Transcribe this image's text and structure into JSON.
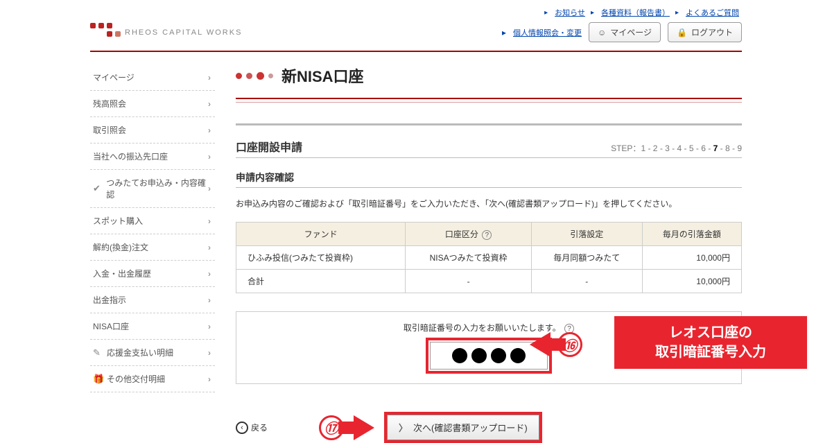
{
  "header": {
    "top_links": [
      "お知らせ",
      "各種資料（報告書）",
      "よくあるご質問"
    ],
    "personal_info": "個人情報照会・変更",
    "mypage_btn": "マイページ",
    "logout_btn": "ログアウト",
    "brand": "RHEOS CAPITAL WORKS"
  },
  "sidebar": {
    "items": [
      {
        "label": "マイページ",
        "icon": ""
      },
      {
        "label": "残高照会",
        "icon": ""
      },
      {
        "label": "取引照会",
        "icon": ""
      },
      {
        "label": "当社への振込先口座",
        "icon": ""
      },
      {
        "label": "つみたてお申込み・内容確認",
        "icon": "✔"
      },
      {
        "label": "スポット購入",
        "icon": ""
      },
      {
        "label": "解約(換金)注文",
        "icon": ""
      },
      {
        "label": "入金・出金履歴",
        "icon": ""
      },
      {
        "label": "出金指示",
        "icon": ""
      },
      {
        "label": "NISA口座",
        "icon": ""
      },
      {
        "label": "応援金支払い明細",
        "icon": "✎"
      },
      {
        "label": "その他交付明細",
        "icon": "🎁"
      }
    ]
  },
  "main": {
    "page_title": "新NISA口座",
    "section_title": "口座開設申請",
    "step_prefix": "STEP：",
    "steps": [
      "1",
      "2",
      "3",
      "4",
      "5",
      "6",
      "7",
      "8",
      "9"
    ],
    "current_step": "7",
    "sub_section": "申請内容確認",
    "instruction": "お申込み内容のご確認および「取引暗証番号」をご入力いただき、「次へ(確認書類アップロード)」を押してください。",
    "table": {
      "headers": [
        "ファンド",
        "口座区分",
        "引落設定",
        "毎月の引落金額"
      ],
      "row1": [
        "ひふみ投信(つみたて投資枠)",
        "NISAつみたて投資枠",
        "毎月同額つみたて",
        "10,000円"
      ],
      "row2": [
        "合計",
        "-",
        "-",
        "10,000円"
      ]
    },
    "pin_label": "取引暗証番号の入力をお願いいたします。",
    "back_label": "戻る",
    "next_label": "次へ(確認書類アップロード)"
  },
  "annotations": {
    "num16": "⑯",
    "num17": "⑰",
    "note_line1": "レオス口座の",
    "note_line2": "取引暗証番号入力"
  }
}
